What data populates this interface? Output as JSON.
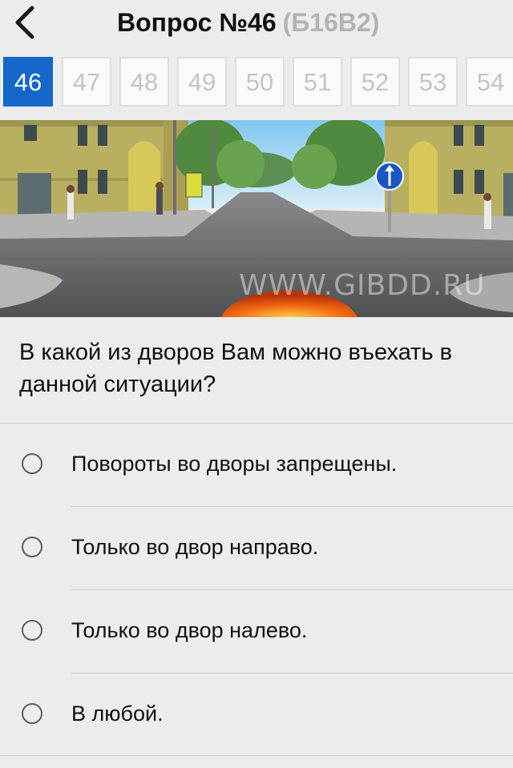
{
  "header": {
    "title": "Вопрос №46",
    "ticket_code": "(Б16В2)",
    "back_icon": "chevron-left-icon"
  },
  "question_numbers": {
    "items": [
      "46",
      "47",
      "48",
      "49",
      "50",
      "51",
      "52",
      "53",
      "54"
    ],
    "active": "46",
    "active_color": "#1367c9"
  },
  "image": {
    "watermark": "WWW.GIBDD.RU",
    "sign": "straight-ahead-sign-icon"
  },
  "question": {
    "text": "В какой из дворов Вам можно въехать в данной ситуации?"
  },
  "answers": [
    {
      "label": "Повороты во дворы запрещены."
    },
    {
      "label": "Только во двор направо."
    },
    {
      "label": "Только во двор налево."
    },
    {
      "label": "В любой."
    }
  ]
}
